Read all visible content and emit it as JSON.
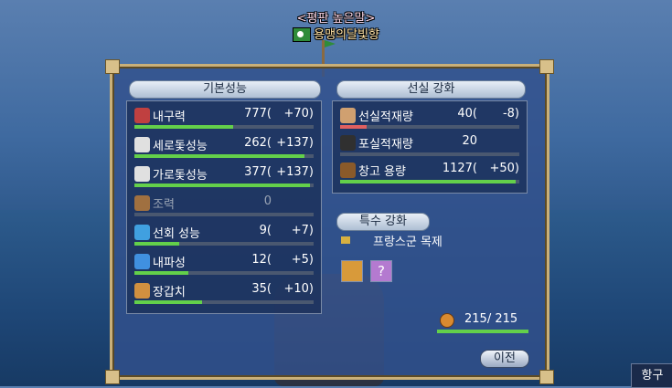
{
  "title": {
    "prefix": "<평판 높은말>",
    "ship_name": "용맹의달빛향"
  },
  "basic": {
    "header": "기본성능",
    "stats": [
      {
        "name": "durability",
        "label": "내구력",
        "value": "777(",
        "bonus": "+70)",
        "fill": 0.55,
        "icon_color": "#c04040"
      },
      {
        "name": "vertical-sail",
        "label": "세로돛성능",
        "value": "262(",
        "bonus": "+137)",
        "fill": 0.95,
        "icon_color": "#e0e0e0"
      },
      {
        "name": "horizontal-sail",
        "label": "가로돛성능",
        "value": "377(",
        "bonus": "+137)",
        "fill": 0.98,
        "icon_color": "#e0e0e0"
      },
      {
        "name": "oar",
        "label": "조력",
        "value": "0",
        "bonus": "",
        "fill": 0.0,
        "icon_color": "#a07040",
        "disabled": true
      },
      {
        "name": "turning",
        "label": "선회 성능",
        "value": "9(",
        "bonus": "+7)",
        "fill": 0.25,
        "icon_color": "#40a0e0"
      },
      {
        "name": "wave-resistance",
        "label": "내파성",
        "value": "12(",
        "bonus": "+5)",
        "fill": 0.3,
        "icon_color": "#4090e0"
      },
      {
        "name": "armor",
        "label": "장갑치",
        "value": "35(",
        "bonus": "+10)",
        "fill": 0.38,
        "icon_color": "#d09040"
      }
    ]
  },
  "cabin": {
    "header": "선실 강화",
    "stats": [
      {
        "name": "sailor-capacity",
        "label": "선실적재량",
        "value": "40(",
        "bonus": "-8)",
        "fill": 0.15,
        "red": true,
        "icon_color": "#d0a070"
      },
      {
        "name": "cannon-capacity",
        "label": "포실적재량",
        "value": "20",
        "bonus": "",
        "fill": 0.0,
        "icon_color": "#303030"
      },
      {
        "name": "cargo-capacity",
        "label": "창고 용량",
        "value": "1127(",
        "bonus": "+50)",
        "fill": 0.98,
        "icon_color": "#8a5a2a"
      }
    ]
  },
  "special": {
    "header": "특수 강화",
    "item_label": "프랑스군 목제"
  },
  "capacity": {
    "value": "215/ 215",
    "fill": 1.0
  },
  "buttons": {
    "prev": "이전",
    "question": "?",
    "port": "항구"
  }
}
